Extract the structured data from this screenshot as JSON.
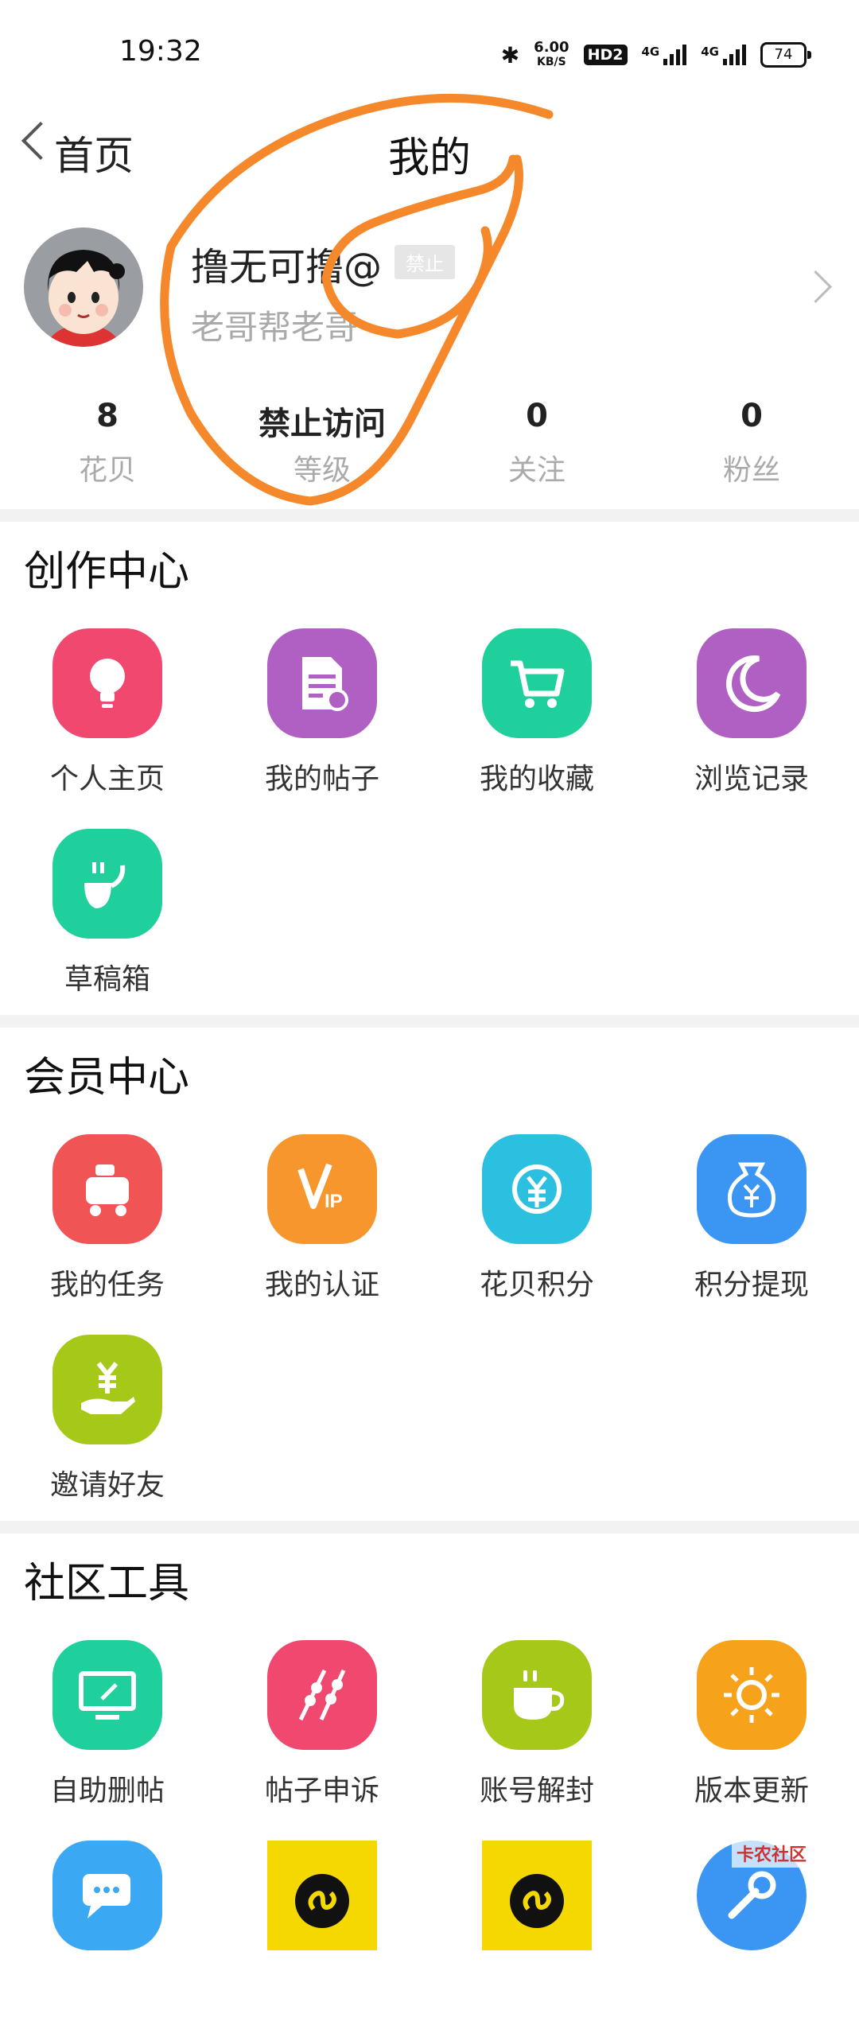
{
  "status_bar": {
    "time": "19:32",
    "speed_value": "6.00",
    "speed_unit": "KB/S",
    "hd": "HD2",
    "net1": "4G",
    "net2": "4G",
    "battery": "74"
  },
  "nav": {
    "back_label": "首页",
    "title": "我的"
  },
  "profile": {
    "username": "撸无可撸@",
    "badge": "禁止",
    "bio": "老哥帮老哥"
  },
  "stats": [
    {
      "value": "8",
      "label": "花贝"
    },
    {
      "value": "禁止访问",
      "label": "等级"
    },
    {
      "value": "0",
      "label": "关注"
    },
    {
      "value": "0",
      "label": "粉丝"
    }
  ],
  "sections": [
    {
      "title": "创作中心",
      "items": [
        {
          "label": "个人主页",
          "icon": "lightbulb-icon",
          "color": "#f0486e"
        },
        {
          "label": "我的帖子",
          "icon": "document-icon",
          "color": "#b05fc2"
        },
        {
          "label": "我的收藏",
          "icon": "shopping-cart-icon",
          "color": "#1fcf9c"
        },
        {
          "label": "浏览记录",
          "icon": "moon-icon",
          "color": "#b05fc2"
        },
        {
          "label": "草稿箱",
          "icon": "draft-icon",
          "color": "#1fcf9c"
        }
      ]
    },
    {
      "title": "会员中心",
      "items": [
        {
          "label": "我的任务",
          "icon": "task-icon",
          "color": "#f05454"
        },
        {
          "label": "我的认证",
          "icon": "vip-icon",
          "color": "#f7962d"
        },
        {
          "label": "花贝积分",
          "icon": "yuan-exchange-icon",
          "color": "#2cc0e0"
        },
        {
          "label": "积分提现",
          "icon": "money-bag-icon",
          "color": "#3a96f2"
        },
        {
          "label": "邀请好友",
          "icon": "gift-hand-icon",
          "color": "#a6c919"
        }
      ]
    },
    {
      "title": "社区工具",
      "items": [
        {
          "label": "自助删帖",
          "icon": "monitor-edit-icon",
          "color": "#1fcf9c"
        },
        {
          "label": "帖子申诉",
          "icon": "skewer-icon",
          "color": "#f0486e"
        },
        {
          "label": "账号解封",
          "icon": "coffee-cup-icon",
          "color": "#a6c919"
        },
        {
          "label": "版本更新",
          "icon": "sun-icon",
          "color": "#f7a21b"
        },
        {
          "label": "",
          "icon": "chat-icon",
          "color": "#3aa8f2"
        },
        {
          "label": "",
          "icon": "mini-program-icon",
          "color": "#f5d800"
        },
        {
          "label": "",
          "icon": "mini-program-icon",
          "color": "#f5d800"
        },
        {
          "label": "",
          "icon": "wrench-icon",
          "color": "#3a96f2"
        }
      ]
    }
  ],
  "watermark": "卡农社区"
}
